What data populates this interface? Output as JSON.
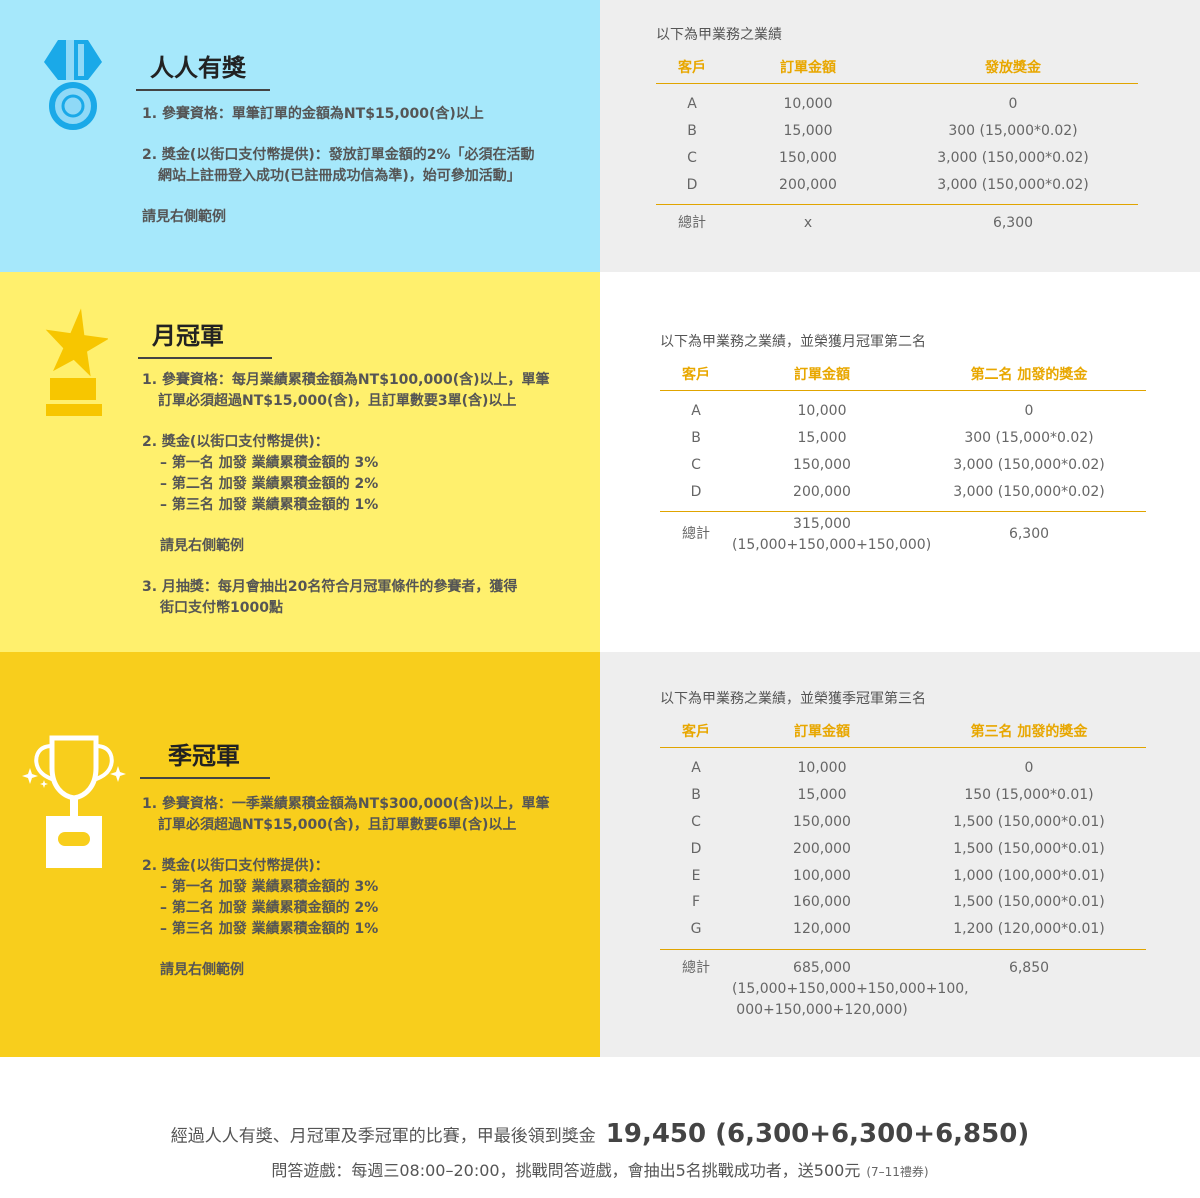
{
  "section1": {
    "title": "人人有獎",
    "rule1": "1. 參賽資格：單筆訂單的金額為NT$15,000(含)以上",
    "rule2_line1": "2. 獎金(以街口支付幣提供)：發放訂單金額的2%「必須在活動",
    "rule2_line2": "網站上註冊登入成功(已註冊成功信為準)，始可參加活動」",
    "see_example": "請見右側範例",
    "table": {
      "caption": "以下為甲業務之業績",
      "headers": [
        "客戶",
        "訂單金額",
        "發放獎金"
      ],
      "rows": [
        [
          "A",
          "10,000",
          "0"
        ],
        [
          "B",
          "15,000",
          "300 (15,000*0.02)"
        ],
        [
          "C",
          "150,000",
          "3,000 (150,000*0.02)"
        ],
        [
          "D",
          "200,000",
          "3,000 (150,000*0.02)"
        ]
      ],
      "total_label": "總計",
      "total_amount": "x",
      "total_bonus": "6,300"
    }
  },
  "section2": {
    "title": "月冠軍",
    "rule1_line1": "1. 參賽資格：每月業績累積金額為NT$100,000(含)以上，單筆",
    "rule1_line2": "訂單必須超過NT$15,000(含)，且訂單數要3單(含)以上",
    "rule2_head": "2. 獎金(以街口支付幣提供)：",
    "rule2_items": [
      "– 第一名 加發 業績累積金額的 3%",
      "– 第二名 加發 業績累積金額的 2%",
      "– 第三名 加發 業績累積金額的 1%"
    ],
    "see_example": "請見右側範例",
    "rule3_line1": "3. 月抽獎：每月會抽出20名符合月冠軍條件的參賽者，獲得",
    "rule3_line2": "街口支付幣1000點",
    "table": {
      "caption": "以下為甲業務之業績，並榮獲月冠軍第二名",
      "headers": [
        "客戶",
        "訂單金額",
        "第二名 加發的獎金"
      ],
      "rows": [
        [
          "A",
          "10,000",
          "0"
        ],
        [
          "B",
          "15,000",
          "300 (15,000*0.02)"
        ],
        [
          "C",
          "150,000",
          "3,000 (150,000*0.02)"
        ],
        [
          "D",
          "200,000",
          "3,000 (150,000*0.02)"
        ]
      ],
      "total_label": "總計",
      "total_amount_line1": "315,000",
      "total_amount_line2": "(15,000+150,000+150,000)",
      "total_bonus": "6,300"
    }
  },
  "section3": {
    "title": "季冠軍",
    "rule1_line1": "1. 參賽資格：一季業績累積金額為NT$300,000(含)以上，單筆",
    "rule1_line2": "訂單必須超過NT$15,000(含)，且訂單數要6單(含)以上",
    "rule2_head": "2. 獎金(以街口支付幣提供)：",
    "rule2_items": [
      "– 第一名 加發 業績累積金額的 3%",
      "– 第二名 加發 業績累積金額的 2%",
      "– 第三名 加發 業績累積金額的 1%"
    ],
    "see_example": "請見右側範例",
    "table": {
      "caption": "以下為甲業務之業績，並榮獲季冠軍第三名",
      "headers": [
        "客戶",
        "訂單金額",
        "第三名 加發的獎金"
      ],
      "rows": [
        [
          "A",
          "10,000",
          "0"
        ],
        [
          "B",
          "15,000",
          "150 (15,000*0.01)"
        ],
        [
          "C",
          "150,000",
          "1,500 (150,000*0.01)"
        ],
        [
          "D",
          "200,000",
          "1,500 (150,000*0.01)"
        ],
        [
          "E",
          "100,000",
          "1,000 (100,000*0.01)"
        ],
        [
          "F",
          "160,000",
          "1,500 (150,000*0.01)"
        ],
        [
          "G",
          "120,000",
          "1,200 (120,000*0.01)"
        ]
      ],
      "total_label": "總計",
      "total_amount_line1": "685,000",
      "total_amount_line2": "(15,000+150,000+150,000+100,",
      "total_amount_line3": "000+150,000+120,000)",
      "total_bonus": "6,850"
    }
  },
  "footer": {
    "summary_text": "經過人人有獎、月冠軍及季冠軍的比賽，甲最後領到獎金",
    "summary_amount": "19,450 (6,300+6,300+6,850)",
    "quiz_text": "問答遊戲：每週三08:00–20:00，挑戰問答遊戲，會抽出5名挑戰成功者，送500元",
    "quiz_note": "(7–11禮券)"
  },
  "icons": {
    "section1": "medal-icon",
    "section2": "star-trophy-icon",
    "section3": "cup-trophy-icon"
  },
  "colors": {
    "band1_left": "#a6e8fb",
    "band2_left": "#fff06d",
    "band3_left": "#f8ce1c",
    "right_gray": "#eeeeee",
    "table_accent": "#e8a700",
    "medal_blue": "#1aa9e8",
    "star_yellow": "#f7c600"
  }
}
